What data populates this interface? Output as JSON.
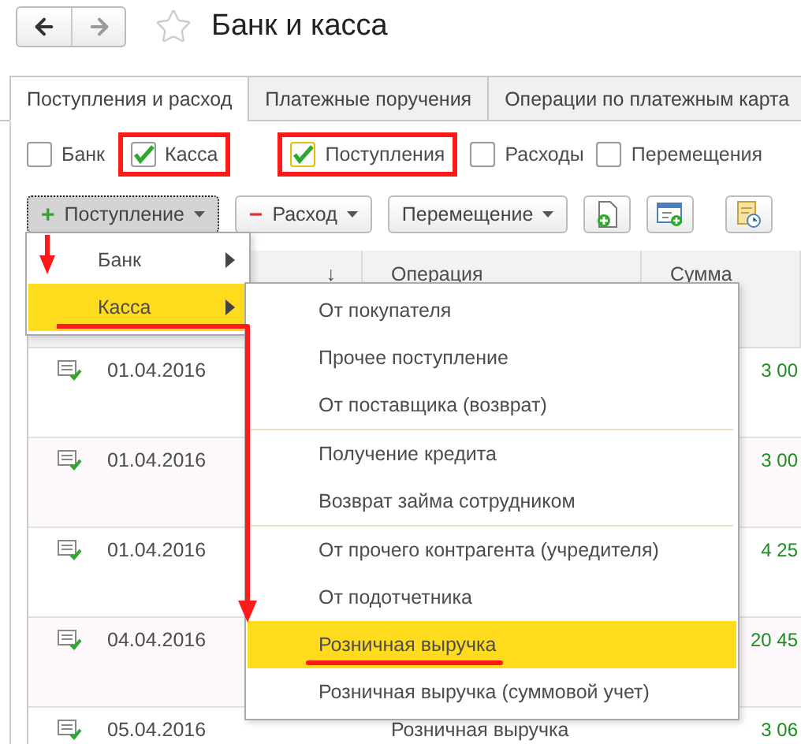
{
  "window": {
    "title": "Банк и касса"
  },
  "tabs": [
    {
      "label": "Поступления и расход",
      "selected": true
    },
    {
      "label": "Платежные поручения",
      "selected": false
    },
    {
      "label": "Операции по платежным карта",
      "selected": false
    }
  ],
  "filters": [
    {
      "label": "Банк",
      "checked": false,
      "focused": false,
      "annotated": false
    },
    {
      "label": "Касса",
      "checked": true,
      "focused": false,
      "annotated": true
    },
    {
      "label": "Поступления",
      "checked": true,
      "focused": true,
      "annotated": true
    },
    {
      "label": "Расходы",
      "checked": false,
      "focused": false,
      "annotated": false
    },
    {
      "label": "Перемещения",
      "checked": false,
      "focused": false,
      "annotated": false
    }
  ],
  "toolbar": [
    {
      "kind": "dropdown",
      "sign": "+",
      "label": "Поступление",
      "pressed": true
    },
    {
      "kind": "dropdown",
      "sign": "−",
      "label": "Расход",
      "pressed": false
    },
    {
      "kind": "dropdown",
      "label": "Перемещение",
      "pressed": false
    },
    {
      "kind": "document"
    },
    {
      "kind": "form"
    },
    {
      "kind": "report"
    }
  ],
  "table": {
    "columns": [
      "↓",
      "Операция",
      "Сумма"
    ],
    "rows": [
      {
        "date": "01.04.2016",
        "amount": "3 00",
        "posted": true
      },
      {
        "date": "01.04.2016",
        "amount": "3 00",
        "posted": true
      },
      {
        "date": "01.04.2016",
        "amount": "4 25",
        "posted": true
      },
      {
        "date": "04.04.2016",
        "amount": "20 45",
        "posted": true
      },
      {
        "date": "05.04.2016",
        "operation": "Розничная выручка",
        "amount": "3 06",
        "posted": true
      }
    ]
  },
  "menu": {
    "items": [
      {
        "label": "Банк",
        "selected": false
      },
      {
        "label": "Касса",
        "selected": true
      }
    ]
  },
  "submenu": {
    "groups": [
      {
        "items": [
          {
            "label": "От покупателя",
            "selected": false
          },
          {
            "label": "Прочее поступление",
            "selected": false
          },
          {
            "label": "От поставщика (возврат)",
            "selected": false
          }
        ]
      },
      {
        "items": [
          {
            "label": "Получение кредита",
            "selected": false
          },
          {
            "label": "Возврат займа сотрудником",
            "selected": false
          }
        ]
      },
      {
        "items": [
          {
            "label": "От прочего контрагента (учредителя)",
            "selected": false
          },
          {
            "label": "От подотчетника",
            "selected": false
          },
          {
            "label": "Розничная выручка",
            "selected": true
          },
          {
            "label": "Розничная выручка (суммовой учет)",
            "selected": false
          }
        ]
      }
    ]
  }
}
